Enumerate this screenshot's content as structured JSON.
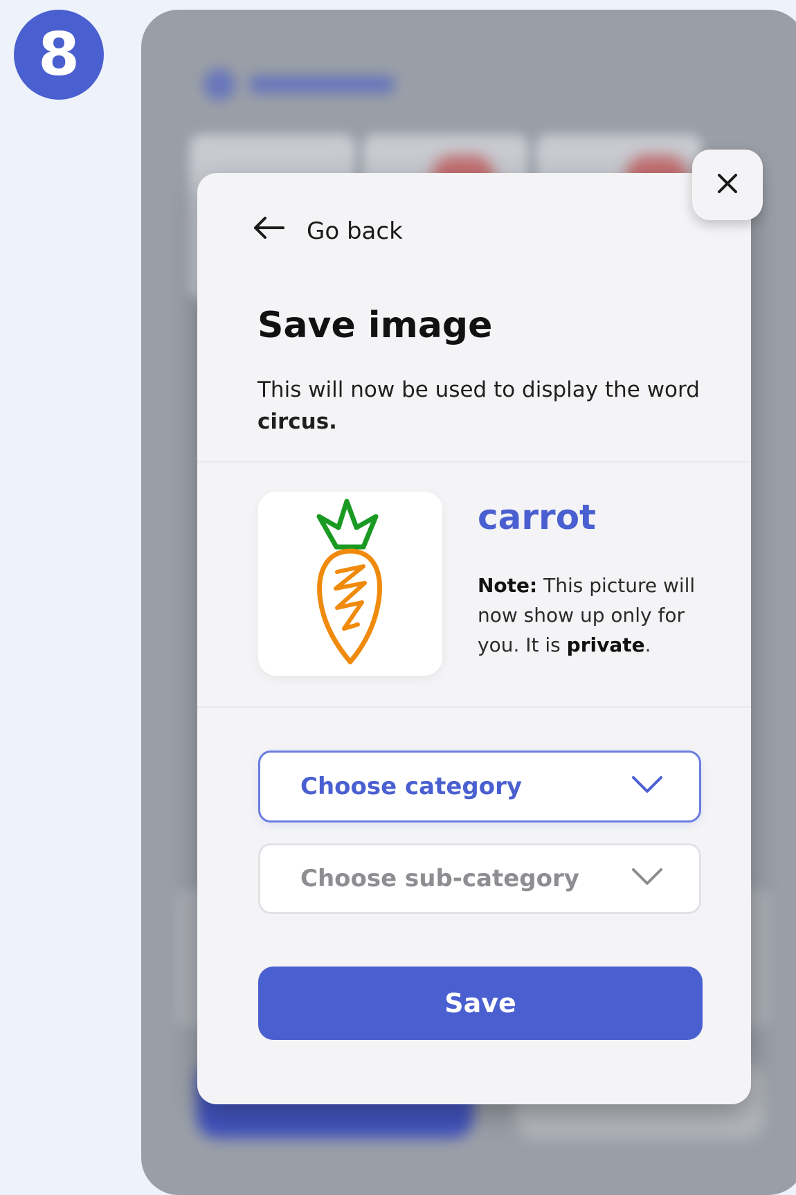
{
  "step_number": "8",
  "modal": {
    "go_back_label": "Go back",
    "title": "Save image",
    "description_prefix": "This will now be used to display the word ",
    "description_word": "circus.",
    "image_word": "carrot",
    "note_label": "Note:",
    "note_text": " This picture will now show up only for you. It is ",
    "note_emphasis": "private",
    "note_suffix": ".",
    "category_select": {
      "placeholder": "Choose category"
    },
    "subcategory_select": {
      "placeholder": "Choose sub-category"
    },
    "save_label": "Save"
  },
  "icons": {
    "back": "arrow-left-icon",
    "close": "close-icon",
    "chevron": "chevron-down-icon",
    "image": "carrot-drawing"
  },
  "colors": {
    "accent": "#4a5fd0",
    "page_background": "#edf2fb",
    "modal_background": "#f4f4f6"
  }
}
